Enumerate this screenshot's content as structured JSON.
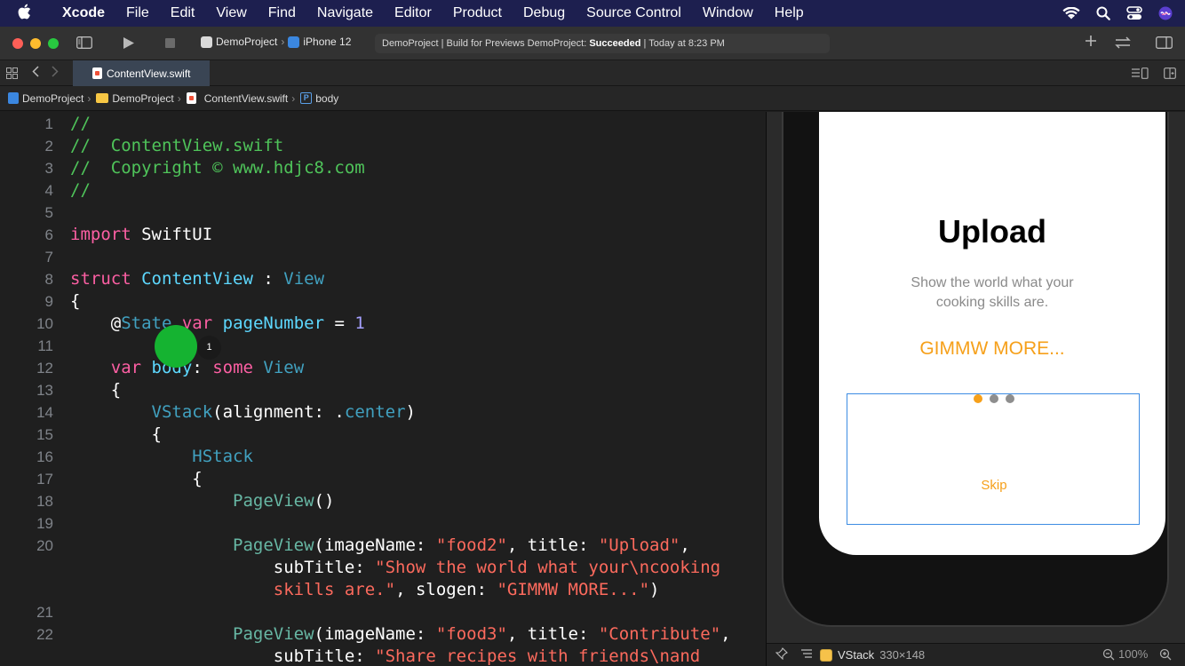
{
  "menubar": {
    "app_name": "Xcode",
    "items": [
      "File",
      "Edit",
      "View",
      "Find",
      "Navigate",
      "Editor",
      "Product",
      "Debug",
      "Source Control",
      "Window",
      "Help"
    ]
  },
  "toolbar": {
    "scheme": "DemoProject",
    "device": "iPhone 12",
    "status_prefix": "DemoProject | Build for Previews DemoProject:",
    "status_result": "Succeeded",
    "status_time": "| Today at 8:23 PM"
  },
  "tab": {
    "label": "ContentView.swift"
  },
  "jumpbar": [
    "DemoProject",
    "DemoProject",
    "ContentView.swift",
    "body"
  ],
  "editor": {
    "lines": [
      {
        "n": "1",
        "tokens": [
          {
            "c": "cm",
            "t": "//"
          }
        ]
      },
      {
        "n": "2",
        "tokens": [
          {
            "c": "cm",
            "t": "//  ContentView.swift"
          }
        ]
      },
      {
        "n": "3",
        "tokens": [
          {
            "c": "cm",
            "t": "//  Copyright © www.hdjc8.com"
          }
        ]
      },
      {
        "n": "4",
        "tokens": [
          {
            "c": "cm",
            "t": "//"
          }
        ]
      },
      {
        "n": "5",
        "tokens": []
      },
      {
        "n": "6",
        "tokens": [
          {
            "c": "kw",
            "t": "import"
          },
          {
            "c": "pl",
            "t": " SwiftUI"
          }
        ]
      },
      {
        "n": "7",
        "tokens": []
      },
      {
        "n": "8",
        "tokens": [
          {
            "c": "kw",
            "t": "struct"
          },
          {
            "c": "pl",
            "t": " "
          },
          {
            "c": "ty",
            "t": "ContentView"
          },
          {
            "c": "pl",
            "t": " : "
          },
          {
            "c": "ty2",
            "t": "View"
          }
        ]
      },
      {
        "n": "9",
        "tokens": [
          {
            "c": "pl",
            "t": "{"
          }
        ]
      },
      {
        "n": "10",
        "tokens": [
          {
            "c": "pl",
            "t": "    @"
          },
          {
            "c": "ty2",
            "t": "State"
          },
          {
            "c": "pl",
            "t": " "
          },
          {
            "c": "kw",
            "t": "var"
          },
          {
            "c": "pl",
            "t": " "
          },
          {
            "c": "ty",
            "t": "pageNumber"
          },
          {
            "c": "pl",
            "t": " = "
          },
          {
            "c": "num",
            "t": "1"
          }
        ]
      },
      {
        "n": "11",
        "tokens": []
      },
      {
        "n": "12",
        "tokens": [
          {
            "c": "pl",
            "t": "    "
          },
          {
            "c": "kw",
            "t": "var"
          },
          {
            "c": "pl",
            "t": " "
          },
          {
            "c": "ty",
            "t": "body"
          },
          {
            "c": "pl",
            "t": ": "
          },
          {
            "c": "kw",
            "t": "some"
          },
          {
            "c": "pl",
            "t": " "
          },
          {
            "c": "ty2",
            "t": "View"
          }
        ]
      },
      {
        "n": "13",
        "tokens": [
          {
            "c": "pl",
            "t": "    {"
          }
        ]
      },
      {
        "n": "14",
        "tokens": [
          {
            "c": "pl",
            "t": "        "
          },
          {
            "c": "ty2",
            "t": "VStack"
          },
          {
            "c": "pl",
            "t": "(alignment: ."
          },
          {
            "c": "ty2",
            "t": "center"
          },
          {
            "c": "pl",
            "t": ")"
          }
        ]
      },
      {
        "n": "15",
        "tokens": [
          {
            "c": "pl",
            "t": "        {"
          }
        ]
      },
      {
        "n": "16",
        "tokens": [
          {
            "c": "pl",
            "t": "            "
          },
          {
            "c": "ty2",
            "t": "HStack"
          }
        ]
      },
      {
        "n": "17",
        "tokens": [
          {
            "c": "pl",
            "t": "            {"
          }
        ]
      },
      {
        "n": "18",
        "tokens": [
          {
            "c": "pl",
            "t": "                "
          },
          {
            "c": "fn",
            "t": "PageView"
          },
          {
            "c": "pl",
            "t": "()"
          }
        ]
      },
      {
        "n": "19",
        "tokens": []
      },
      {
        "n": "20",
        "tokens": [
          {
            "c": "pl",
            "t": "                "
          },
          {
            "c": "fn",
            "t": "PageView"
          },
          {
            "c": "pl",
            "t": "(imageName: "
          },
          {
            "c": "str",
            "t": "\"food2\""
          },
          {
            "c": "pl",
            "t": ", title: "
          },
          {
            "c": "str",
            "t": "\"Upload\""
          },
          {
            "c": "pl",
            "t": ","
          }
        ]
      },
      {
        "n": "",
        "tokens": [
          {
            "c": "pl",
            "t": "                    subTitle: "
          },
          {
            "c": "str",
            "t": "\"Show the world what your\\ncooking"
          }
        ]
      },
      {
        "n": "",
        "tokens": [
          {
            "c": "pl",
            "t": "                    "
          },
          {
            "c": "str",
            "t": "skills are.\""
          },
          {
            "c": "pl",
            "t": ", slogen: "
          },
          {
            "c": "str",
            "t": "\"GIMMW MORE...\""
          },
          {
            "c": "pl",
            "t": ")"
          }
        ]
      },
      {
        "n": "21",
        "tokens": []
      },
      {
        "n": "22",
        "tokens": [
          {
            "c": "pl",
            "t": "                "
          },
          {
            "c": "fn",
            "t": "PageView"
          },
          {
            "c": "pl",
            "t": "(imageName: "
          },
          {
            "c": "str",
            "t": "\"food3\""
          },
          {
            "c": "pl",
            "t": ", title: "
          },
          {
            "c": "str",
            "t": "\"Contribute\""
          },
          {
            "c": "pl",
            "t": ","
          }
        ]
      },
      {
        "n": "",
        "tokens": [
          {
            "c": "pl",
            "t": "                    subTitle: "
          },
          {
            "c": "str",
            "t": "\"Share recipes with friends\\nand"
          }
        ]
      }
    ],
    "click_badge": "1"
  },
  "preview": {
    "title": "Upload",
    "subtitle": "Show the world what your\ncooking skills are.",
    "slogan": "GIMMW MORE...",
    "skip": "Skip",
    "page_indicator": {
      "count": 3,
      "current": 1
    },
    "colors": {
      "accent": "#f6a01a",
      "selection": "#3d8ce3",
      "dot_inactive": "#8e8e8e"
    }
  },
  "canvas_bar": {
    "selection_label": "VStack",
    "selection_size": "330×148",
    "zoom": "100%"
  }
}
